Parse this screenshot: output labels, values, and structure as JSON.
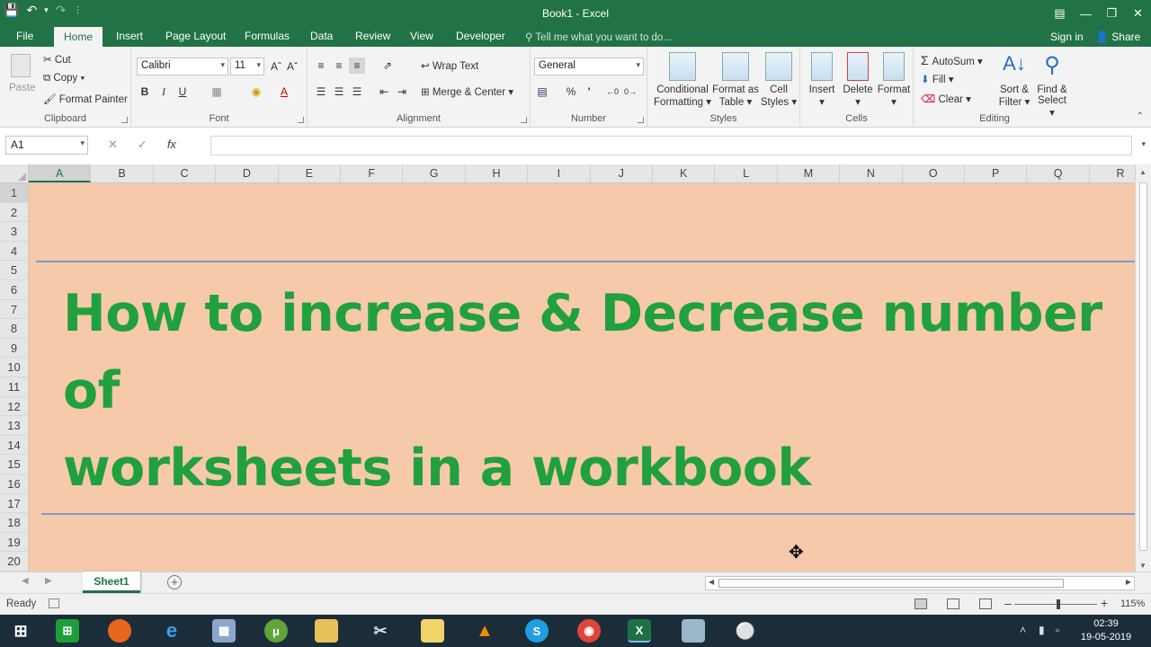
{
  "window": {
    "title": "Book1 - Excel"
  },
  "ribbon_tabs": [
    "File",
    "Home",
    "Insert",
    "Page Layout",
    "Formulas",
    "Data",
    "Review",
    "View",
    "Developer"
  ],
  "tell_me": "Tell me what you want to do...",
  "account": {
    "sign_in": "Sign in",
    "share": "Share"
  },
  "clipboard": {
    "paste": "Paste",
    "cut": "Cut",
    "copy": "Copy",
    "format_painter": "Format Painter",
    "label": "Clipboard"
  },
  "font": {
    "name": "Calibri",
    "size": "11",
    "label": "Font",
    "bold": "B",
    "italic": "I",
    "underline": "U"
  },
  "alignment": {
    "wrap_text": "Wrap Text",
    "merge_center": "Merge & Center",
    "label": "Alignment"
  },
  "number": {
    "format": "General",
    "percent": "%",
    "comma": "’",
    "label": "Number"
  },
  "styles": {
    "conditional_formatting": [
      "Conditional",
      "Formatting"
    ],
    "format_as_table": [
      "Format as",
      "Table"
    ],
    "cell_styles": [
      "Cell",
      "Styles"
    ],
    "label": "Styles"
  },
  "cells": {
    "insert": "Insert",
    "delete": "Delete",
    "format": "Format",
    "label": "Cells"
  },
  "editing": {
    "autosum": "AutoSum",
    "fill": "Fill",
    "clear": "Clear",
    "sort_filter": [
      "Sort &",
      "Filter"
    ],
    "find_select": [
      "Find &",
      "Select"
    ],
    "label": "Editing"
  },
  "formula_bar": {
    "name_box": "A1",
    "fx": "fx"
  },
  "columns": [
    "A",
    "B",
    "C",
    "D",
    "E",
    "F",
    "G",
    "H",
    "I",
    "J",
    "K",
    "L",
    "M",
    "N",
    "O",
    "P",
    "Q",
    "R"
  ],
  "rows": [
    "1",
    "2",
    "3",
    "4",
    "5",
    "6",
    "7",
    "8",
    "9",
    "10",
    "11",
    "12",
    "13",
    "14",
    "15",
    "16",
    "17",
    "18",
    "19",
    "20"
  ],
  "heading": {
    "line1": "How to increase & Decrease number of",
    "line2": "worksheets in a workbook"
  },
  "colors": {
    "excel_green": "#217346",
    "sheet_fill": "#f6c9ab",
    "heading_text": "#21a03e",
    "rule_line": "#7d9ac9"
  },
  "sheet_tabs": [
    "Sheet1"
  ],
  "status": {
    "ready": "Ready",
    "zoom": "115%"
  },
  "taskbar": {
    "time": "02:39",
    "date": "19-05-2019"
  }
}
